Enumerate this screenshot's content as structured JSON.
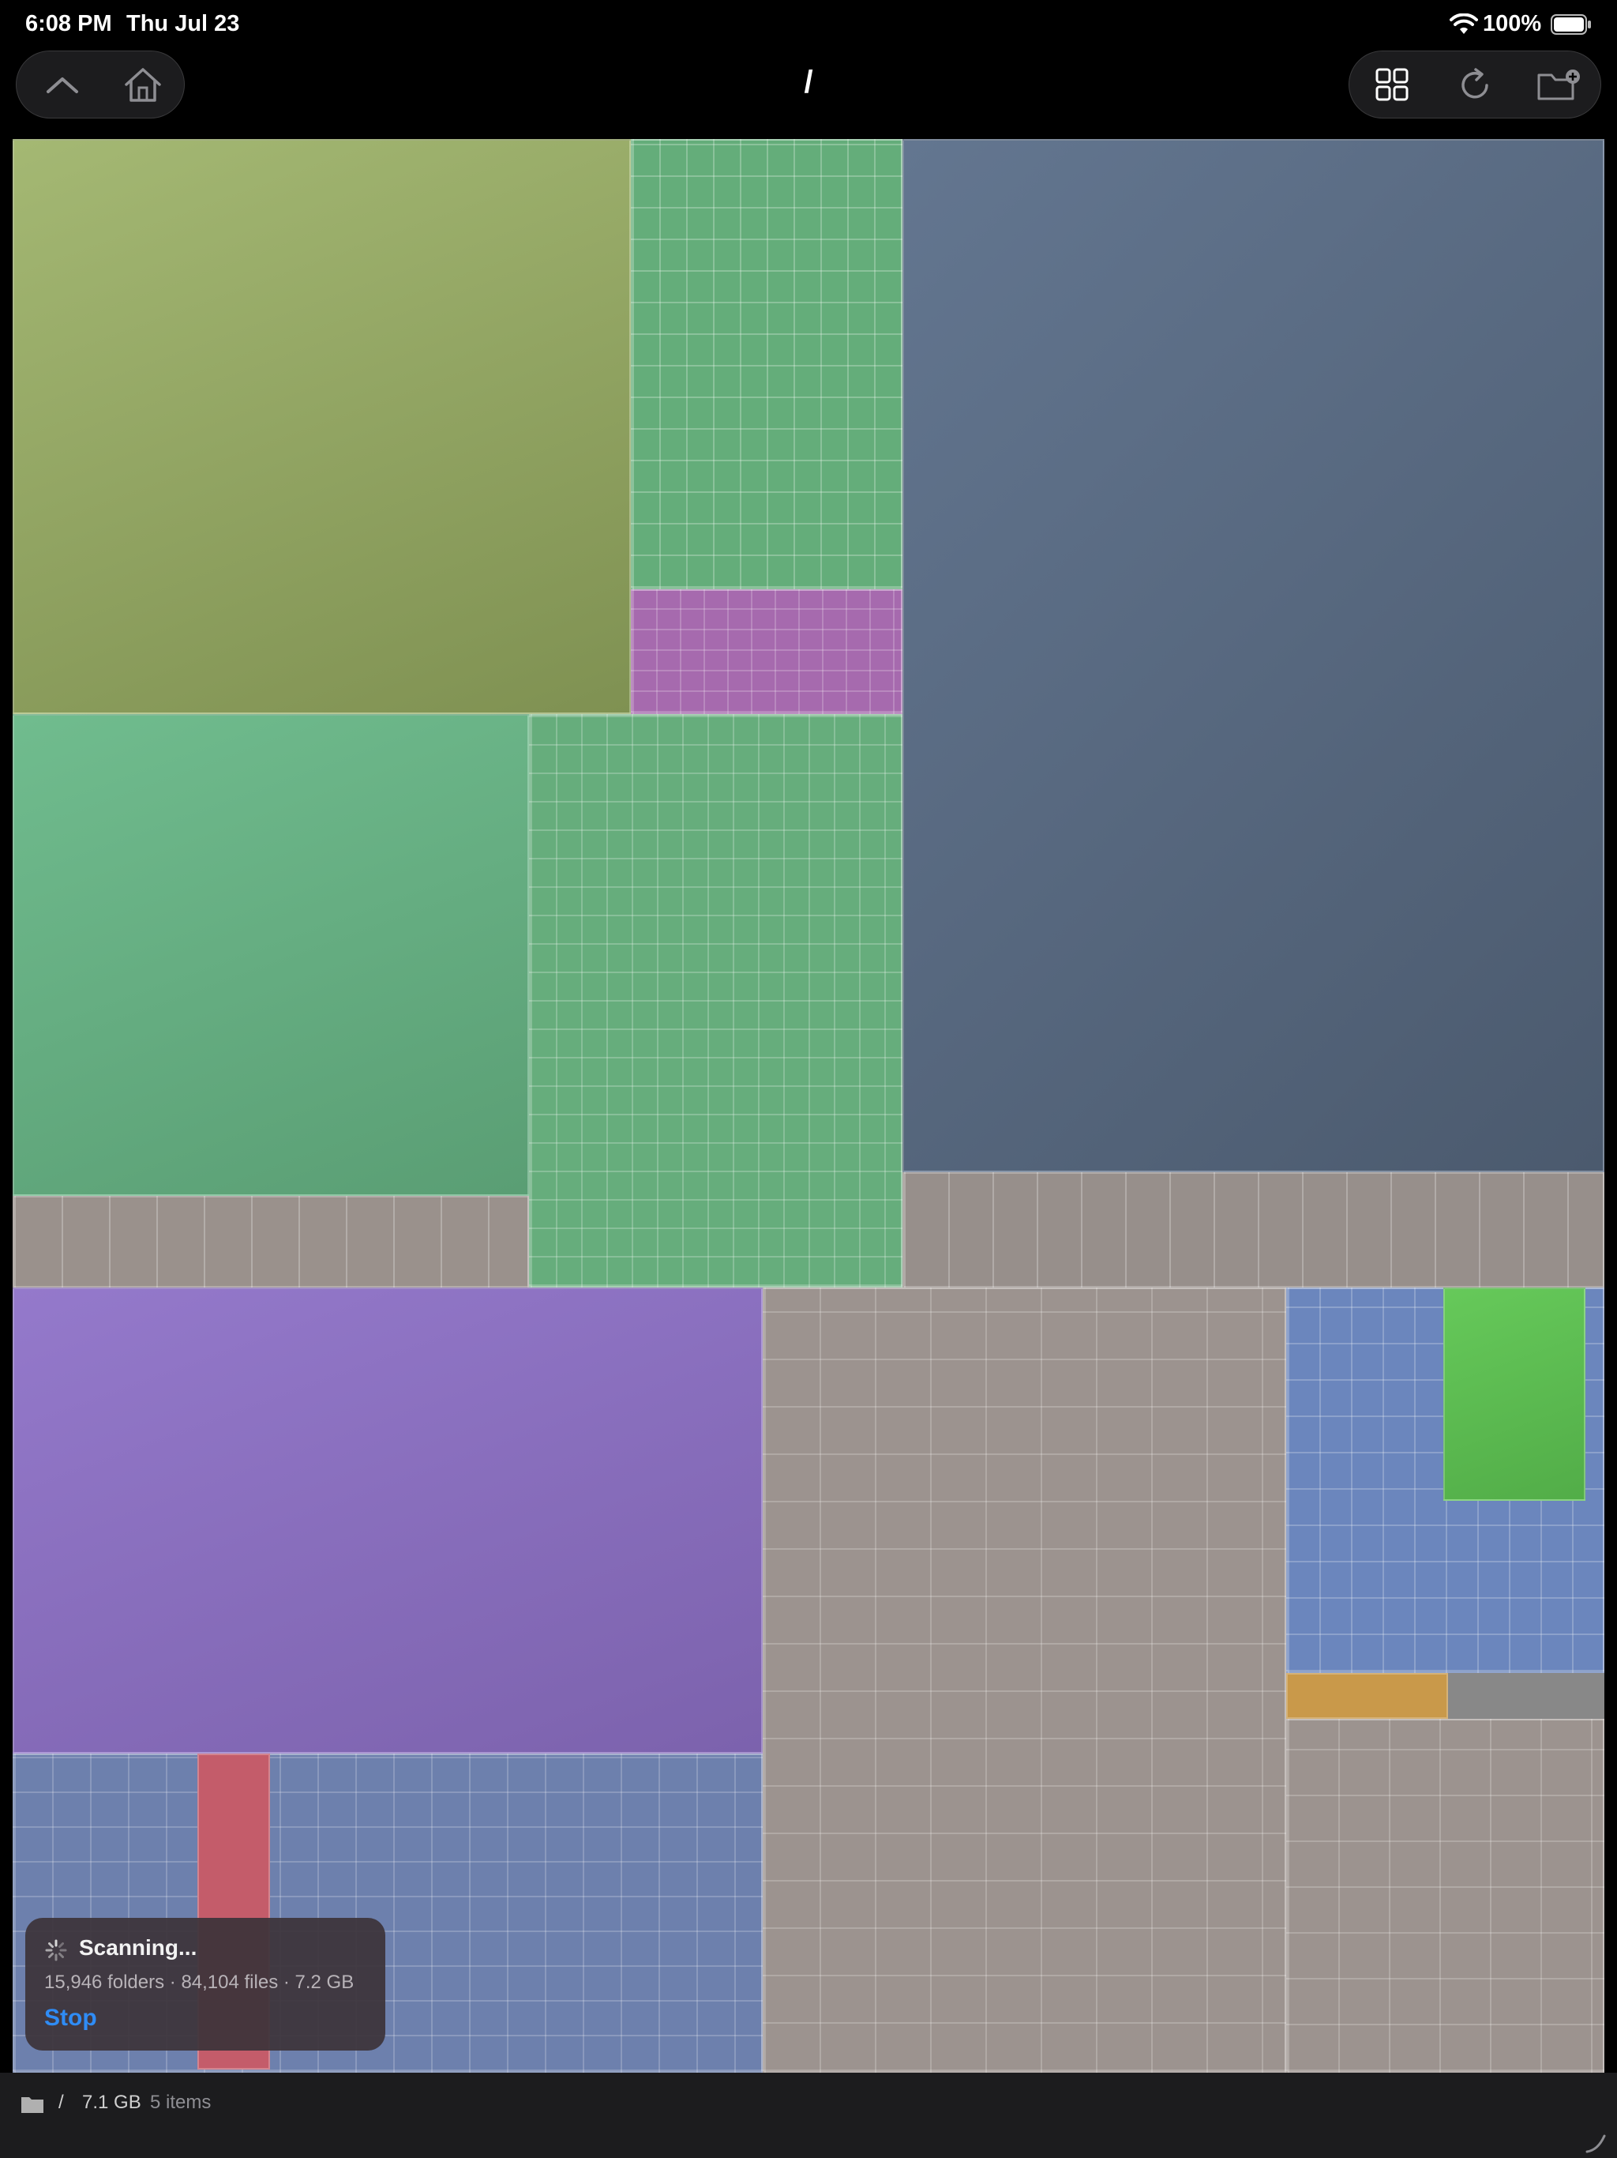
{
  "status_bar": {
    "time": "6:08 PM",
    "date": "Thu Jul 23",
    "battery_percent": "100%"
  },
  "toolbar": {
    "title": "/",
    "left_buttons": [
      "chevron-up-icon",
      "home-icon"
    ],
    "right_buttons": [
      "grid-view-icon",
      "refresh-icon",
      "add-folder-icon"
    ]
  },
  "treemap": {
    "colors": {
      "olive": "#97a865",
      "green": "#6cae84",
      "teal_green": "#6bb07e",
      "slate": "#58687c",
      "gray": "#9d9490",
      "purple": "#8a6fbf",
      "blue": "#6f88b8",
      "red": "#c45c6a",
      "magenta": "#b066b8",
      "bright_green": "#5fbe55",
      "orange": "#c9994a"
    }
  },
  "scan_panel": {
    "title": "Scanning...",
    "stats": "15,946 folders · 84,104 files · 7.2 GB",
    "stop_label": "Stop"
  },
  "bottom_bar": {
    "path": "/",
    "size": "7.1 GB",
    "items": "5 items"
  }
}
